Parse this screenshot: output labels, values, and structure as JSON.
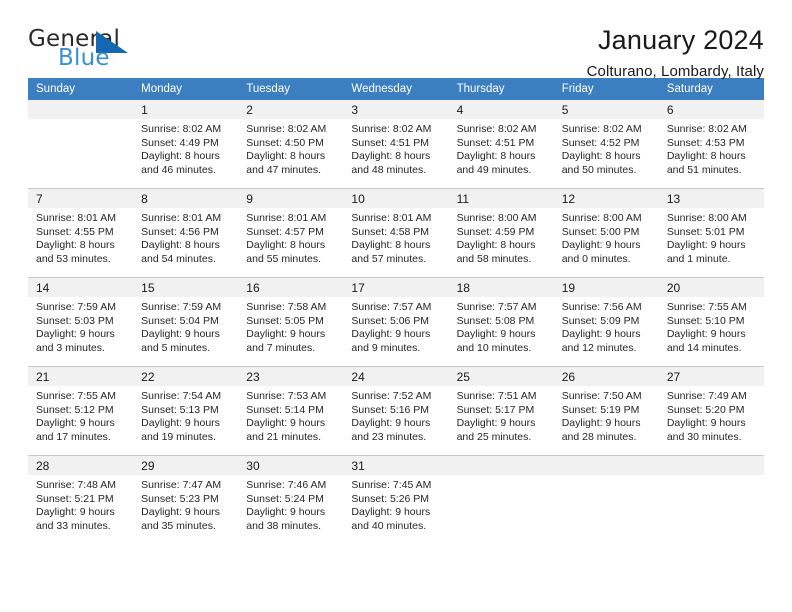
{
  "brand": {
    "name_top": "General",
    "name_bottom": "Blue",
    "accent_color": "#1567b2",
    "text_color": "#3b8ed0"
  },
  "header": {
    "title": "January 2024",
    "subtitle": "Colturano, Lombardy, Italy",
    "header_bg": "#3c7fc1",
    "daynum_bg": "#f1f1f1"
  },
  "weekday_headers": [
    "Sunday",
    "Monday",
    "Tuesday",
    "Wednesday",
    "Thursday",
    "Friday",
    "Saturday"
  ],
  "weeks": [
    [
      {
        "day": "",
        "sunrise": "",
        "sunset": "",
        "daylight1": "",
        "daylight2": "",
        "empty": true
      },
      {
        "day": "1",
        "sunrise": "Sunrise: 8:02 AM",
        "sunset": "Sunset: 4:49 PM",
        "daylight1": "Daylight: 8 hours",
        "daylight2": "and 46 minutes."
      },
      {
        "day": "2",
        "sunrise": "Sunrise: 8:02 AM",
        "sunset": "Sunset: 4:50 PM",
        "daylight1": "Daylight: 8 hours",
        "daylight2": "and 47 minutes."
      },
      {
        "day": "3",
        "sunrise": "Sunrise: 8:02 AM",
        "sunset": "Sunset: 4:51 PM",
        "daylight1": "Daylight: 8 hours",
        "daylight2": "and 48 minutes."
      },
      {
        "day": "4",
        "sunrise": "Sunrise: 8:02 AM",
        "sunset": "Sunset: 4:51 PM",
        "daylight1": "Daylight: 8 hours",
        "daylight2": "and 49 minutes."
      },
      {
        "day": "5",
        "sunrise": "Sunrise: 8:02 AM",
        "sunset": "Sunset: 4:52 PM",
        "daylight1": "Daylight: 8 hours",
        "daylight2": "and 50 minutes."
      },
      {
        "day": "6",
        "sunrise": "Sunrise: 8:02 AM",
        "sunset": "Sunset: 4:53 PM",
        "daylight1": "Daylight: 8 hours",
        "daylight2": "and 51 minutes."
      }
    ],
    [
      {
        "day": "7",
        "sunrise": "Sunrise: 8:01 AM",
        "sunset": "Sunset: 4:55 PM",
        "daylight1": "Daylight: 8 hours",
        "daylight2": "and 53 minutes."
      },
      {
        "day": "8",
        "sunrise": "Sunrise: 8:01 AM",
        "sunset": "Sunset: 4:56 PM",
        "daylight1": "Daylight: 8 hours",
        "daylight2": "and 54 minutes."
      },
      {
        "day": "9",
        "sunrise": "Sunrise: 8:01 AM",
        "sunset": "Sunset: 4:57 PM",
        "daylight1": "Daylight: 8 hours",
        "daylight2": "and 55 minutes."
      },
      {
        "day": "10",
        "sunrise": "Sunrise: 8:01 AM",
        "sunset": "Sunset: 4:58 PM",
        "daylight1": "Daylight: 8 hours",
        "daylight2": "and 57 minutes."
      },
      {
        "day": "11",
        "sunrise": "Sunrise: 8:00 AM",
        "sunset": "Sunset: 4:59 PM",
        "daylight1": "Daylight: 8 hours",
        "daylight2": "and 58 minutes."
      },
      {
        "day": "12",
        "sunrise": "Sunrise: 8:00 AM",
        "sunset": "Sunset: 5:00 PM",
        "daylight1": "Daylight: 9 hours",
        "daylight2": "and 0 minutes."
      },
      {
        "day": "13",
        "sunrise": "Sunrise: 8:00 AM",
        "sunset": "Sunset: 5:01 PM",
        "daylight1": "Daylight: 9 hours",
        "daylight2": "and 1 minute."
      }
    ],
    [
      {
        "day": "14",
        "sunrise": "Sunrise: 7:59 AM",
        "sunset": "Sunset: 5:03 PM",
        "daylight1": "Daylight: 9 hours",
        "daylight2": "and 3 minutes."
      },
      {
        "day": "15",
        "sunrise": "Sunrise: 7:59 AM",
        "sunset": "Sunset: 5:04 PM",
        "daylight1": "Daylight: 9 hours",
        "daylight2": "and 5 minutes."
      },
      {
        "day": "16",
        "sunrise": "Sunrise: 7:58 AM",
        "sunset": "Sunset: 5:05 PM",
        "daylight1": "Daylight: 9 hours",
        "daylight2": "and 7 minutes."
      },
      {
        "day": "17",
        "sunrise": "Sunrise: 7:57 AM",
        "sunset": "Sunset: 5:06 PM",
        "daylight1": "Daylight: 9 hours",
        "daylight2": "and 9 minutes."
      },
      {
        "day": "18",
        "sunrise": "Sunrise: 7:57 AM",
        "sunset": "Sunset: 5:08 PM",
        "daylight1": "Daylight: 9 hours",
        "daylight2": "and 10 minutes."
      },
      {
        "day": "19",
        "sunrise": "Sunrise: 7:56 AM",
        "sunset": "Sunset: 5:09 PM",
        "daylight1": "Daylight: 9 hours",
        "daylight2": "and 12 minutes."
      },
      {
        "day": "20",
        "sunrise": "Sunrise: 7:55 AM",
        "sunset": "Sunset: 5:10 PM",
        "daylight1": "Daylight: 9 hours",
        "daylight2": "and 14 minutes."
      }
    ],
    [
      {
        "day": "21",
        "sunrise": "Sunrise: 7:55 AM",
        "sunset": "Sunset: 5:12 PM",
        "daylight1": "Daylight: 9 hours",
        "daylight2": "and 17 minutes."
      },
      {
        "day": "22",
        "sunrise": "Sunrise: 7:54 AM",
        "sunset": "Sunset: 5:13 PM",
        "daylight1": "Daylight: 9 hours",
        "daylight2": "and 19 minutes."
      },
      {
        "day": "23",
        "sunrise": "Sunrise: 7:53 AM",
        "sunset": "Sunset: 5:14 PM",
        "daylight1": "Daylight: 9 hours",
        "daylight2": "and 21 minutes."
      },
      {
        "day": "24",
        "sunrise": "Sunrise: 7:52 AM",
        "sunset": "Sunset: 5:16 PM",
        "daylight1": "Daylight: 9 hours",
        "daylight2": "and 23 minutes."
      },
      {
        "day": "25",
        "sunrise": "Sunrise: 7:51 AM",
        "sunset": "Sunset: 5:17 PM",
        "daylight1": "Daylight: 9 hours",
        "daylight2": "and 25 minutes."
      },
      {
        "day": "26",
        "sunrise": "Sunrise: 7:50 AM",
        "sunset": "Sunset: 5:19 PM",
        "daylight1": "Daylight: 9 hours",
        "daylight2": "and 28 minutes."
      },
      {
        "day": "27",
        "sunrise": "Sunrise: 7:49 AM",
        "sunset": "Sunset: 5:20 PM",
        "daylight1": "Daylight: 9 hours",
        "daylight2": "and 30 minutes."
      }
    ],
    [
      {
        "day": "28",
        "sunrise": "Sunrise: 7:48 AM",
        "sunset": "Sunset: 5:21 PM",
        "daylight1": "Daylight: 9 hours",
        "daylight2": "and 33 minutes."
      },
      {
        "day": "29",
        "sunrise": "Sunrise: 7:47 AM",
        "sunset": "Sunset: 5:23 PM",
        "daylight1": "Daylight: 9 hours",
        "daylight2": "and 35 minutes."
      },
      {
        "day": "30",
        "sunrise": "Sunrise: 7:46 AM",
        "sunset": "Sunset: 5:24 PM",
        "daylight1": "Daylight: 9 hours",
        "daylight2": "and 38 minutes."
      },
      {
        "day": "31",
        "sunrise": "Sunrise: 7:45 AM",
        "sunset": "Sunset: 5:26 PM",
        "daylight1": "Daylight: 9 hours",
        "daylight2": "and 40 minutes."
      },
      {
        "day": "",
        "sunrise": "",
        "sunset": "",
        "daylight1": "",
        "daylight2": "",
        "empty": true
      },
      {
        "day": "",
        "sunrise": "",
        "sunset": "",
        "daylight1": "",
        "daylight2": "",
        "empty": true
      },
      {
        "day": "",
        "sunrise": "",
        "sunset": "",
        "daylight1": "",
        "daylight2": "",
        "empty": true
      }
    ]
  ]
}
